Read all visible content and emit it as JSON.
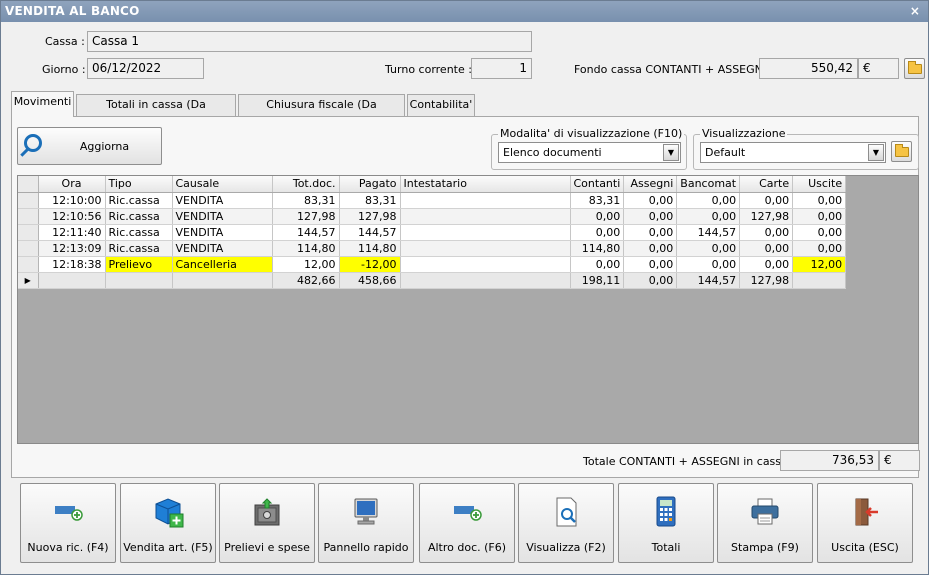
{
  "window": {
    "title": "VENDITA AL BANCO",
    "close": "×"
  },
  "header": {
    "cassa_label": "Cassa :",
    "cassa_value": "Cassa 1",
    "giorno_label": "Giorno :",
    "giorno_value": "06/12/2022",
    "turno_label": "Turno corrente :",
    "turno_value": "1",
    "fondo_label": "Fondo cassa CONTANTI + ASSEGNI :",
    "fondo_value": "550,42",
    "fondo_currency": "€"
  },
  "tabs": [
    {
      "label": "Movimenti",
      "active": true
    },
    {
      "label": "Totali in cassa (Da confermare)",
      "active": false
    },
    {
      "label": "Chiusura fiscale (Da confermare)",
      "active": false
    },
    {
      "label": "Contabilita'",
      "active": false
    }
  ],
  "toolbar": {
    "refresh_label": "Aggiorna",
    "mode_group_label": "Modalita' di visualizzazione (F10)",
    "mode_value": "Elenco documenti",
    "view_group_label": "Visualizzazione",
    "view_value": "Default"
  },
  "table": {
    "columns": [
      "Ora",
      "Tipo",
      "Causale",
      "Tot.doc.",
      "Pagato",
      "Intestatario",
      "Contanti",
      "Assegni",
      "Bancomat",
      "Carte",
      "Uscite"
    ],
    "rows": [
      [
        "12:10:00",
        "Ric.cassa",
        "VENDITA",
        "83,31",
        "83,31",
        "",
        "83,31",
        "0,00",
        "0,00",
        "0,00",
        "0,00"
      ],
      [
        "12:10:56",
        "Ric.cassa",
        "VENDITA",
        "127,98",
        "127,98",
        "",
        "0,00",
        "0,00",
        "0,00",
        "127,98",
        "0,00"
      ],
      [
        "12:11:40",
        "Ric.cassa",
        "VENDITA",
        "144,57",
        "144,57",
        "",
        "0,00",
        "0,00",
        "144,57",
        "0,00",
        "0,00"
      ],
      [
        "12:13:09",
        "Ric.cassa",
        "VENDITA",
        "114,80",
        "114,80",
        "",
        "114,80",
        "0,00",
        "0,00",
        "0,00",
        "0,00"
      ],
      [
        "12:18:38",
        "Prelievo",
        "Cancelleria",
        "12,00",
        "-12,00",
        "",
        "0,00",
        "0,00",
        "0,00",
        "0,00",
        "12,00"
      ]
    ],
    "totals": [
      "",
      "",
      "",
      "482,66",
      "458,66",
      "",
      "198,11",
      "0,00",
      "144,57",
      "127,98",
      ""
    ],
    "highlight_color": "#ffff00"
  },
  "footer": {
    "total_label": "Totale CONTANTI + ASSEGNI in cassa :",
    "total_value": "736,53",
    "total_currency": "€"
  },
  "buttons": [
    {
      "label": "Nuova ric. (F4)",
      "icon": "new-receipt-icon"
    },
    {
      "label": "Vendita art. (F5)",
      "icon": "add-article-box-icon"
    },
    {
      "label": "Prelievi e spese",
      "icon": "safe-icon"
    },
    {
      "label": "Pannello rapido",
      "icon": "monitor-icon"
    },
    {
      "label": "Altro doc. (F6)",
      "icon": "new-document-icon"
    },
    {
      "label": "Visualizza (F2)",
      "icon": "view-document-icon"
    },
    {
      "label": "Totali",
      "icon": "calculator-icon"
    },
    {
      "label": "Stampa (F9)",
      "icon": "printer-icon"
    },
    {
      "label": "Uscita (ESC)",
      "icon": "exit-door-icon"
    }
  ]
}
